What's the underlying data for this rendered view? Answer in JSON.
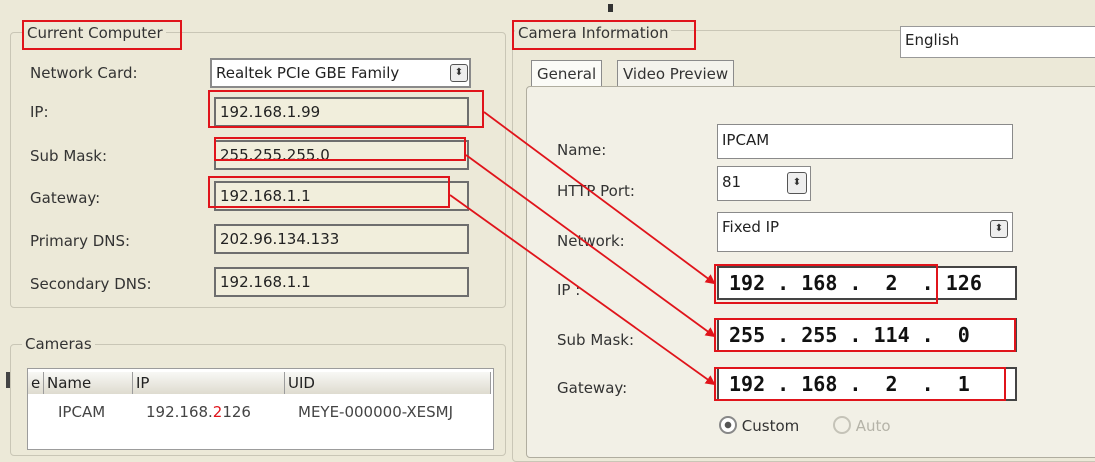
{
  "current_computer": {
    "title": "Current Computer",
    "network_card_label": "Network Card:",
    "network_card_value": "Realtek PCIe GBE Family",
    "ip_label": "IP:",
    "ip_value": "192.168.1.99",
    "submask_label": "Sub Mask:",
    "submask_value": "255.255.255.0",
    "gateway_label": "Gateway:",
    "gateway_value": "192.168.1.1",
    "primary_dns_label": "Primary DNS:",
    "primary_dns_value": "202.96.134.133",
    "secondary_dns_label": "Secondary DNS:",
    "secondary_dns_value": "192.168.1.1"
  },
  "cameras": {
    "title": "Cameras",
    "columns": [
      "e",
      "Name",
      "IP",
      "UID"
    ],
    "rows": [
      {
        "name": "IPCAM",
        "ip_prefix": "192.168.",
        "ip_edit": "2",
        "ip_suffix": "126",
        "uid": "MEYE-000000-XESMJ"
      }
    ]
  },
  "camera_info": {
    "title": "Camera Information",
    "language": "English",
    "tabs": [
      "General",
      "Video Preview"
    ],
    "active_tab": "General",
    "name_label": "Name:",
    "name_value": "IPCAM",
    "http_port_label": "HTTP Port:",
    "http_port_value": "81",
    "network_label": "Network:",
    "network_value": "Fixed IP",
    "ip_label": "IP :",
    "ip_value": "192 . 168 .  2  . 126",
    "submask_label": "Sub Mask:",
    "submask_value": "255 . 255 . 114 .  0",
    "gateway_label": "Gateway:",
    "gateway_value": "192 . 168 .  2  .  1",
    "custom_label": "Custom",
    "auto_label": "Auto"
  },
  "colors": {
    "annotation_red": "#e0141b",
    "panel_bg": "#ece9d8",
    "readonly_bg": "#f1eedc"
  }
}
